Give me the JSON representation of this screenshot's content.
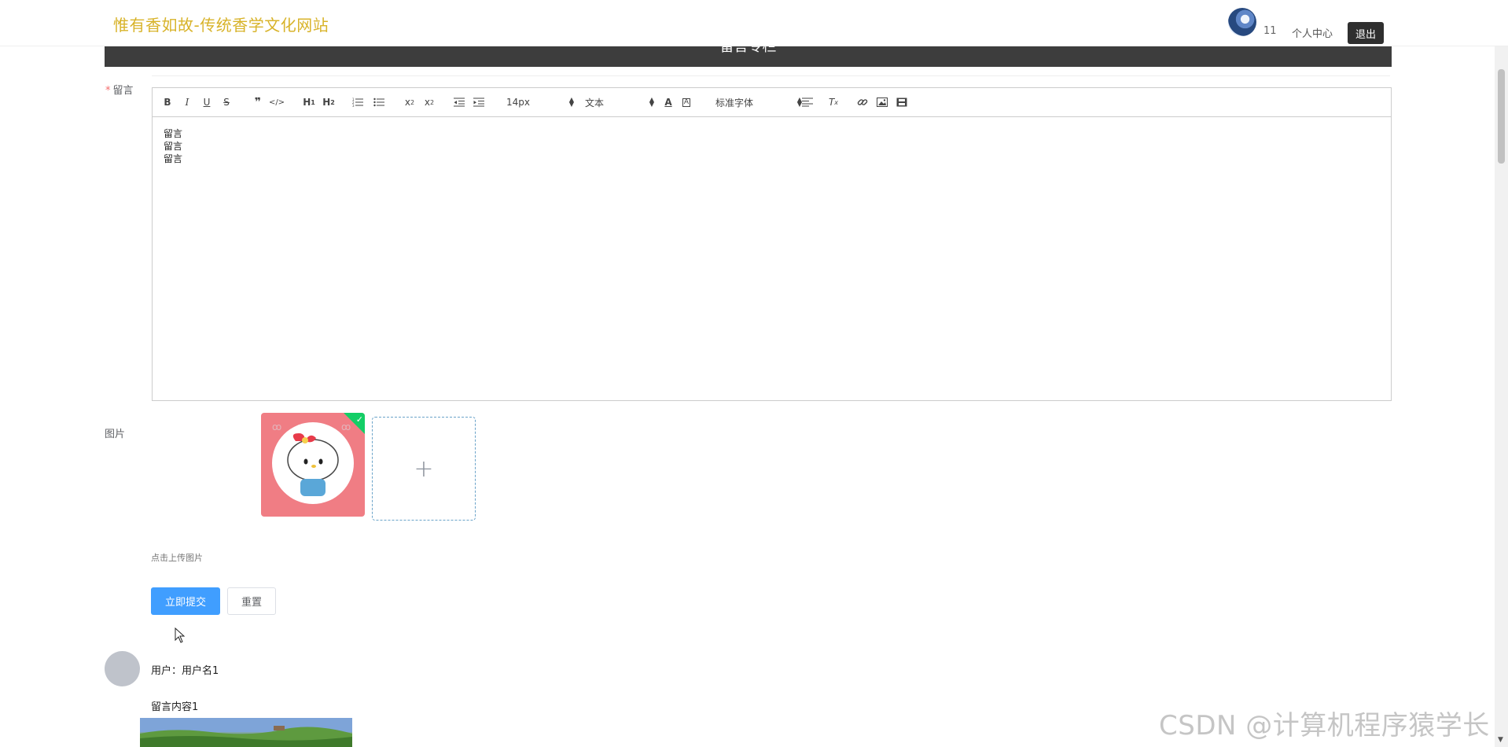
{
  "header": {
    "site_title": "惟有香如故-传统香学文化网站",
    "count": "11",
    "user_center": "个人中心",
    "logout": "退出"
  },
  "section": {
    "title": "留言专栏"
  },
  "form": {
    "message_label": "留言",
    "required_mark": "*",
    "image_label": "图片",
    "upload_tip": "点击上传图片",
    "submit_label": "立即提交",
    "reset_label": "重置"
  },
  "toolbar": {
    "bold": "B",
    "italic": "I",
    "underline": "U",
    "strike": "S",
    "font_size": "14px",
    "header_select": "文本",
    "font_family": "标准字体"
  },
  "editor": {
    "lines": [
      "留言",
      "留言",
      "留言"
    ]
  },
  "comments": [
    {
      "user": "用户：用户名1",
      "content": "留言内容1"
    }
  ],
  "watermark": "CSDN @计算机程序猿学长",
  "colors": {
    "title_gold": "#d8b32a",
    "submit_blue": "#409eff",
    "section_bar": "#3d3d3d",
    "logout_bg": "#2f2f2f",
    "upload_success": "#13ce66"
  }
}
